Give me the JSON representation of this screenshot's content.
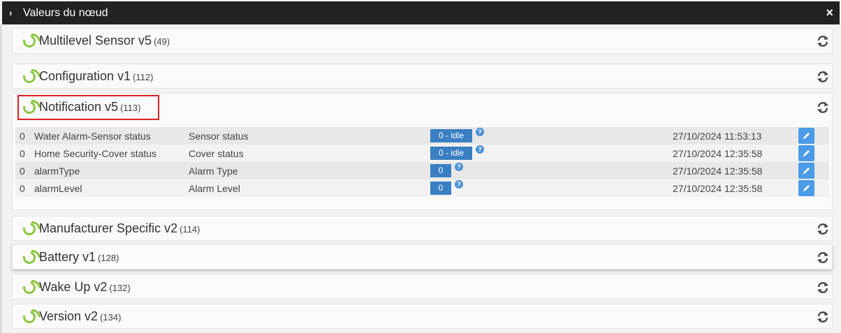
{
  "modal": {
    "title": "Valeurs du nœud",
    "close_glyph": "×",
    "chevron_glyph": "›"
  },
  "panels": [
    {
      "name": "Multilevel Sensor v5",
      "count": "(49)"
    },
    {
      "name": "Configuration v1",
      "count": "(112)"
    },
    {
      "name": "Notification v5",
      "count": "(113)"
    },
    {
      "name": "Manufacturer Specific v2",
      "count": "(114)"
    },
    {
      "name": "Battery v1",
      "count": "(128)"
    },
    {
      "name": "Wake Up v2",
      "count": "(132)"
    },
    {
      "name": "Version v2",
      "count": "(134)"
    }
  ],
  "notification_rows": [
    {
      "instance": "0",
      "label": "Water Alarm-Sensor status",
      "help": "Sensor status",
      "value": "0 - idle",
      "date": "27/10/2024 11:53:13"
    },
    {
      "instance": "0",
      "label": "Home Security-Cover status",
      "help": "Cover status",
      "value": "0 - idle",
      "date": "27/10/2024 12:35:58"
    },
    {
      "instance": "0",
      "label": "alarmType",
      "help": "Alarm Type",
      "value": "0",
      "date": "27/10/2024 12:35:58"
    },
    {
      "instance": "0",
      "label": "alarmLevel",
      "help": "Alarm Level",
      "value": "0",
      "date": "27/10/2024 12:35:58"
    }
  ],
  "question_glyph": "?",
  "colors": {
    "titlebar": "#222222",
    "ring": "#8cc63f",
    "badge": "#3a7fc1",
    "edit_button": "#4b9be8",
    "highlight": "#e02020"
  },
  "icons": {
    "panel_status": "loading-ring-icon",
    "refresh": "refresh-icon",
    "edit": "pencil-icon",
    "help": "question-icon"
  }
}
